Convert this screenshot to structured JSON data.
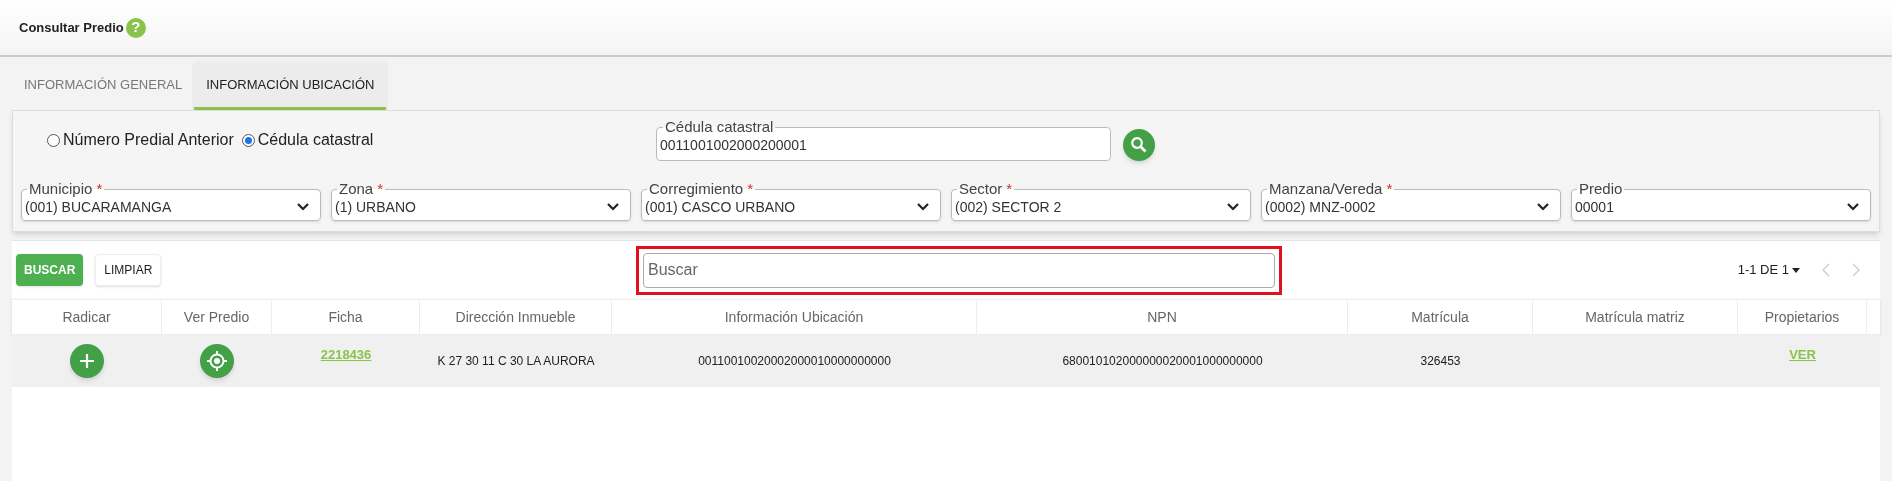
{
  "header": {
    "title": "Consultar Predio",
    "help": "?"
  },
  "tabs": [
    {
      "label": "INFORMACIÓN GENERAL",
      "selected": false
    },
    {
      "label": "INFORMACIÓN UBICACIÓN",
      "selected": true
    }
  ],
  "search_mode": [
    {
      "label": "Número Predial Anterior",
      "selected": false
    },
    {
      "label": "Cédula catastral",
      "selected": true
    }
  ],
  "cedula_field": {
    "label": "Cédula catastral",
    "value": "0011001002000200001"
  },
  "selects": [
    {
      "label": "Municipio",
      "required_mark": "*",
      "value": "(001) BUCARAMANGA"
    },
    {
      "label": "Zona",
      "required_mark": "*",
      "value": "(1) URBANO"
    },
    {
      "label": "Corregimiento",
      "required_mark": "*",
      "value": "(001) CASCO URBANO"
    },
    {
      "label": "Sector",
      "required_mark": "*",
      "value": "(002) SECTOR 2"
    },
    {
      "label": "Manzana/Vereda",
      "required_mark": "*",
      "value": "(0002) MNZ-0002"
    },
    {
      "label": "Predio",
      "value": "00001"
    }
  ],
  "buttons": [
    {
      "label": "BUSCAR",
      "kind": "primary"
    },
    {
      "label": "LIMPIAR",
      "kind": "secondary"
    }
  ],
  "table_search": {
    "placeholder": "Buscar",
    "highlighted": true
  },
  "pagination": {
    "label": "1-1 DE 1"
  },
  "table": {
    "columns": [
      "Radicar",
      "Ver Predio",
      "Ficha",
      "Dirección Inmueble",
      "Información Ubicación",
      "NPN",
      "Matrícula",
      "Matrícula matriz",
      "Propietarios"
    ],
    "rows": [
      {
        "cells": [
          {
            "kind": "add"
          },
          {
            "kind": "locate"
          },
          {
            "kind": "link",
            "text": "2218436"
          },
          {
            "kind": "text",
            "text": "K 27 30 11 C 30 LA AURORA"
          },
          {
            "kind": "text",
            "text": "00110010020002000010000000000"
          },
          {
            "kind": "text",
            "text": "680010102000000020001000000000"
          },
          {
            "kind": "text",
            "text": "326453"
          },
          {
            "kind": "empty"
          },
          {
            "kind": "link",
            "text": "VER"
          }
        ]
      }
    ]
  }
}
